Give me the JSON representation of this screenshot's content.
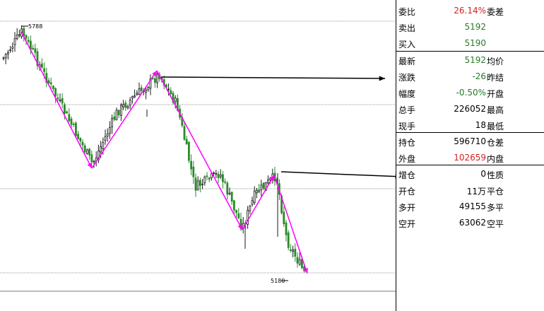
{
  "colors": {
    "up_candle": "#1a1a1a",
    "down_candle": "#2a8a2a",
    "trend": "#ff00ff",
    "red_value": "#d42020",
    "green_value": "#2a7a2a",
    "grid": "#9a9a9a"
  },
  "chart": {
    "high_label": "5788",
    "low_label": "5180"
  },
  "quote": {
    "rows": [
      {
        "label": "委比",
        "value": "26.14%",
        "label2": "委差",
        "color": "red"
      },
      {
        "label": "卖出",
        "value": "5192",
        "label2": "",
        "color": "green"
      },
      {
        "label": "买入",
        "value": "5190",
        "label2": "",
        "color": "green"
      },
      {
        "label": "最新",
        "value": "5192",
        "label2": "均价",
        "color": "green"
      },
      {
        "label": "涨跌",
        "value": "-26",
        "label2": "昨结",
        "color": "green"
      },
      {
        "label": "幅度",
        "value": "-0.50%",
        "label2": "开盘",
        "color": "green"
      },
      {
        "label": "总手",
        "value": "226052",
        "label2": "最高",
        "color": "black"
      },
      {
        "label": "现手",
        "value": "18",
        "label2": "最低",
        "color": "black"
      },
      {
        "label": "持仓",
        "value": "596710",
        "label2": "仓差",
        "color": "black"
      },
      {
        "label": "外盘",
        "value": "102659",
        "label2": "内盘",
        "color": "red"
      },
      {
        "label": "增仓",
        "value": "0",
        "label2": "性质",
        "color": "black"
      },
      {
        "label": "开仓",
        "value": "11万",
        "label2": "平仓",
        "color": "black"
      },
      {
        "label": "多开",
        "value": "49155",
        "label2": "多平",
        "color": "black"
      },
      {
        "label": "空开",
        "value": "63062",
        "label2": "空平",
        "color": "black"
      }
    ]
  }
}
